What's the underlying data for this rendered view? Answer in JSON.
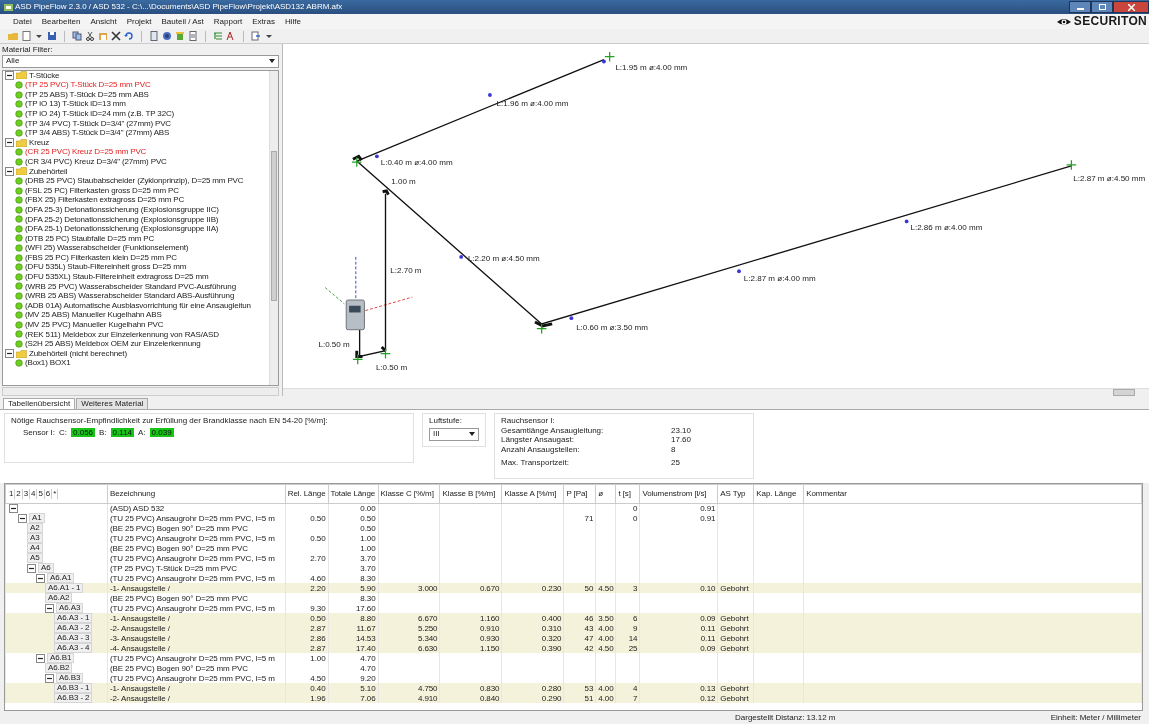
{
  "window": {
    "title": "ASD PipeFlow 2.3.0 / ASD 532 - C:\\...\\Documents\\ASD PipeFlow\\Projekt\\ASD132 ABRM.afx"
  },
  "menu": [
    "Datei",
    "Bearbeiten",
    "Ansicht",
    "Projekt",
    "Bauteil / Ast",
    "Rapport",
    "Extras",
    "Hilfe"
  ],
  "logo": {
    "text": "SECURITON"
  },
  "material_filter": {
    "label": "Material Filter:",
    "value": "Alle"
  },
  "material_tree": [
    {
      "label": "T-Stücke",
      "expanded": true,
      "children": [
        {
          "label": "(TP 25 PVC) T-Stück D=25 mm PVC",
          "highlighted": true
        },
        {
          "label": "(TP 25 ABS) T-Stück D=25 mm ABS",
          "highlighted": false
        },
        {
          "label": "(TP iO 13) T-Stück iD=13 mm",
          "highlighted": false
        },
        {
          "label": "(TP iO 24) T-Stück iD=24 mm (z.B. TP 32C)",
          "highlighted": false
        },
        {
          "label": "(TP 3/4 PVC) T-Stück D=3/4\" (27mm) PVC",
          "highlighted": false
        },
        {
          "label": "(TP 3/4 ABS) T-Stück D=3/4\" (27mm) ABS",
          "highlighted": false
        }
      ]
    },
    {
      "label": "Kreuz",
      "expanded": true,
      "children": [
        {
          "label": "(CR 25 PVC) Kreuz D=25 mm PVC",
          "highlighted": true
        },
        {
          "label": "(CR 3/4 PVC) Kreuz D=3/4\" (27mm) PVC",
          "highlighted": false
        }
      ]
    },
    {
      "label": "Zubehörteil",
      "expanded": true,
      "children": [
        {
          "label": "(DRB 25 PVC) Staubabscheider (Zyklonprinzip), D=25 mm PVC",
          "highlighted": false
        },
        {
          "label": "(FSL 25 PC) Filterkasten gross D=25 mm PC",
          "highlighted": false
        },
        {
          "label": "(FBX 25) Filterkasten extragross D=25 mm PC",
          "highlighted": false
        },
        {
          "label": "(DFA 25-3) Detonationssicherung (Explosionsgruppe IIC)",
          "highlighted": false
        },
        {
          "label": "(DFA 25-2) Detonationssicherung (Explosionsgruppe IIB)",
          "highlighted": false
        },
        {
          "label": "(DFA 25-1) Detonationssicherung (Explosionsgruppe IIA)",
          "highlighted": false
        },
        {
          "label": "(DTB 25 PC) Staubfalle D=25 mm PC",
          "highlighted": false
        },
        {
          "label": "(WFI 25) Wasserabscheider (Funktionselement)",
          "highlighted": false
        },
        {
          "label": "(FBS 25 PC) Filterkasten klein D=25 mm PC",
          "highlighted": false
        },
        {
          "label": "(DFU 535L) Staub-Filtereinheit gross D=25 mm",
          "highlighted": false
        },
        {
          "label": "(DFU 535XL) Staub-Filtereinheit extragross D=25 mm",
          "highlighted": false
        },
        {
          "label": "(WRB 25 PVC) Wasserabscheider Standard PVC-Ausführung",
          "highlighted": false
        },
        {
          "label": "(WRB 25 ABS) Wasserabscheider Standard ABS-Ausführung",
          "highlighted": false
        },
        {
          "label": "(ADB 01A) Automatische Ausblasvorrichtung für eine Ansaugleitun",
          "highlighted": false
        },
        {
          "label": "(MV 25 ABS) Manueller Kugelhahn ABS",
          "highlighted": false
        },
        {
          "label": "(MV 25 PVC) Manueller Kugelhahn PVC",
          "highlighted": false
        },
        {
          "label": "(REK 511) Meldebox zur Einzelerkennung von RAS/ASD",
          "highlighted": false
        },
        {
          "label": "(S2H 25 ABS) Meldebox OEM zur Einzelerkennung",
          "highlighted": false
        }
      ]
    },
    {
      "label": "Zubehörteil (nicht berechnet)",
      "expanded": true,
      "children": [
        {
          "label": "(Box1) BOX1",
          "highlighted": false
        }
      ]
    }
  ],
  "diagram": {
    "labels": [
      "L:1.95 m ø:4.00 mm",
      "L:1.96 m ø:4.00 mm",
      "L:0.40 m ø:4.00 mm",
      "1.00 m",
      "L:2.70 m",
      "L:2.20 m ø:4.50 mm",
      "L:0.60 m ø:3.50 mm",
      "L:2.87 m ø:4.00 mm",
      "L:2.86 m ø:4.00 mm",
      "L:2.87 m ø:4.50 mm",
      "L:0.50 m",
      "L:0.50 m"
    ]
  },
  "tabs": [
    {
      "label": "Tabellenübersicht",
      "selected": true
    },
    {
      "label": "Weiteres Material",
      "selected": false
    }
  ],
  "sensitivity": {
    "title": "Nötige Rauchsensor-Empfindlichkeit zur Erfüllung der Brandklasse nach EN 54-20 [%/m]:",
    "sensor": "Sensor I:",
    "classes": [
      {
        "label": "C:",
        "value": "0.056"
      },
      {
        "label": "B:",
        "value": "0.114"
      },
      {
        "label": "A:",
        "value": "0.039"
      }
    ]
  },
  "air_level": {
    "label": "Luftstufe:",
    "value": "III"
  },
  "sensor_summary": {
    "title": "Rauchsensor I:",
    "rows": [
      {
        "label": "Gesamtlänge Ansaugleitung:",
        "value": "23.10"
      },
      {
        "label": "Längster Ansaugast:",
        "value": "17.60"
      },
      {
        "label": "Anzahl Ansaugstellen:",
        "value": "8"
      },
      {
        "label": "Max. Transportzeit:",
        "value": "25"
      }
    ]
  },
  "table": {
    "level_columns": [
      "1",
      "2",
      "3",
      "4",
      "5",
      "6",
      "*"
    ],
    "columns": [
      "Bezeichnung",
      "Rel. Länge",
      "Totale Länge",
      "Klasse C [%/m]",
      "Klasse B [%/m]",
      "Klasse A [%/m]",
      "P [Pa]",
      "ø",
      "t [s]",
      "Volumenstrom [l/s]",
      "AS Typ",
      "Kap. Länge",
      "Kommentar"
    ],
    "rows": [
      {
        "kind": "pipe",
        "expanded": true,
        "name": "(ASD) ASD 532",
        "total_length": "0.00",
        "time": "0",
        "flow": "0.91",
        "children": [
          {
            "id": "A1",
            "kind": "pipe",
            "expanded": true,
            "name": "(TU 25 PVC) Ansaugrohr D=25 mm PVC, l=5 m",
            "rel_length": "0.50",
            "total_length": "0.50",
            "pressure": "71",
            "time": "0",
            "flow": "0.91",
            "children": [
              {
                "id": "A2",
                "kind": "pipe",
                "name": "(BE 25 PVC) Bogen 90° D=25 mm PVC",
                "total_length": "0.50"
              },
              {
                "id": "A3",
                "kind": "pipe",
                "name": "(TU 25 PVC) Ansaugrohr D=25 mm PVC, l=5 m",
                "rel_length": "0.50",
                "total_length": "1.00"
              },
              {
                "id": "A4",
                "kind": "pipe",
                "name": "(BE 25 PVC) Bogen 90° D=25 mm PVC",
                "total_length": "1.00"
              },
              {
                "id": "A5",
                "kind": "pipe",
                "name": "(TU 25 PVC) Ansaugrohr D=25 mm PVC, l=5 m",
                "rel_length": "2.70",
                "total_length": "3.70"
              },
              {
                "id": "A6",
                "kind": "pipe",
                "expanded": true,
                "name": "(TP 25 PVC) T-Stück D=25 mm PVC",
                "total_length": "3.70",
                "children": [
                  {
                    "id": "A6.A1",
                    "kind": "pipe",
                    "expanded": true,
                    "name": "(TU 25 PVC) Ansaugrohr D=25 mm PVC, l=5 m",
                    "rel_length": "4.60",
                    "total_length": "8.30",
                    "children": [
                      {
                        "id": "A6.A1 - 1",
                        "kind": "sampling_point",
                        "name": "-1- Ansaugstelle /",
                        "rel_length": "2.20",
                        "total_length": "5.90",
                        "class_c": "3.000",
                        "class_b": "0.670",
                        "class_a": "0.230",
                        "pressure": "50",
                        "bore": "4.50",
                        "time": "3",
                        "flow": "0.10",
                        "type": "Gebohrt"
                      },
                      {
                        "id": "A6.A2",
                        "kind": "pipe",
                        "name": "(BE 25 PVC) Bogen 90° D=25 mm PVC",
                        "total_length": "8.30"
                      },
                      {
                        "id": "A6.A3",
                        "kind": "pipe",
                        "expanded": true,
                        "name": "(TU 25 PVC) Ansaugrohr D=25 mm PVC, l=5 m",
                        "rel_length": "9.30",
                        "total_length": "17.60",
                        "children": [
                          {
                            "id": "A6.A3 - 1",
                            "kind": "sampling_point",
                            "name": "-1- Ansaugstelle /",
                            "rel_length": "0.50",
                            "total_length": "8.80",
                            "class_c": "6.670",
                            "class_b": "1.160",
                            "class_a": "0.400",
                            "pressure": "46",
                            "bore": "3.50",
                            "time": "6",
                            "flow": "0.09",
                            "type": "Gebohrt"
                          },
                          {
                            "id": "A6.A3 - 2",
                            "kind": "sampling_point",
                            "name": "-2- Ansaugstelle /",
                            "rel_length": "2.87",
                            "total_length": "11.67",
                            "class_c": "5.250",
                            "class_b": "0.910",
                            "class_a": "0.310",
                            "pressure": "43",
                            "bore": "4.00",
                            "time": "9",
                            "flow": "0.11",
                            "type": "Gebohrt"
                          },
                          {
                            "id": "A6.A3 - 3",
                            "kind": "sampling_point",
                            "name": "-3- Ansaugstelle /",
                            "rel_length": "2.86",
                            "total_length": "14.53",
                            "class_c": "5.340",
                            "class_b": "0.930",
                            "class_a": "0.320",
                            "pressure": "47",
                            "bore": "4.00",
                            "time": "14",
                            "flow": "0.11",
                            "type": "Gebohrt"
                          },
                          {
                            "id": "A6.A3 - 4",
                            "kind": "sampling_point",
                            "name": "-4- Ansaugstelle /",
                            "rel_length": "2.87",
                            "total_length": "17.40",
                            "class_c": "6.630",
                            "class_b": "1.150",
                            "class_a": "0.390",
                            "pressure": "42",
                            "bore": "4.50",
                            "time": "25",
                            "flow": "0.09",
                            "type": "Gebohrt"
                          }
                        ]
                      }
                    ]
                  },
                  {
                    "id": "A6.B1",
                    "kind": "pipe",
                    "expanded": true,
                    "name": "(TU 25 PVC) Ansaugrohr D=25 mm PVC, l=5 m",
                    "rel_length": "1.00",
                    "total_length": "4.70",
                    "children": [
                      {
                        "id": "A6.B2",
                        "kind": "pipe",
                        "name": "(BE 25 PVC) Bogen 90° D=25 mm PVC",
                        "total_length": "4.70"
                      },
                      {
                        "id": "A6.B3",
                        "kind": "pipe",
                        "expanded": true,
                        "name": "(TU 25 PVC) Ansaugrohr D=25 mm PVC, l=5 m",
                        "rel_length": "4.50",
                        "total_length": "9.20",
                        "children": [
                          {
                            "id": "A6.B3 - 1",
                            "kind": "sampling_point",
                            "name": "-1- Ansaugstelle /",
                            "rel_length": "0.40",
                            "total_length": "5.10",
                            "class_c": "4.750",
                            "class_b": "0.830",
                            "class_a": "0.280",
                            "pressure": "53",
                            "bore": "4.00",
                            "time": "4",
                            "flow": "0.13",
                            "type": "Gebohrt"
                          },
                          {
                            "id": "A6.B3 - 2",
                            "kind": "sampling_point",
                            "name": "-2- Ansaugstelle /",
                            "rel_length": "1.96",
                            "total_length": "7.06",
                            "class_c": "4.910",
                            "class_b": "0.840",
                            "class_a": "0.290",
                            "pressure": "51",
                            "bore": "4.00",
                            "time": "7",
                            "flow": "0.12",
                            "type": "Gebohrt"
                          }
                        ]
                      }
                    ]
                  }
                ]
              }
            ]
          }
        ]
      }
    ]
  },
  "status_bar": {
    "distance": "Dargestellt Distanz: 13.12 m",
    "unit": "Einheit: Meter / Millimeter"
  }
}
